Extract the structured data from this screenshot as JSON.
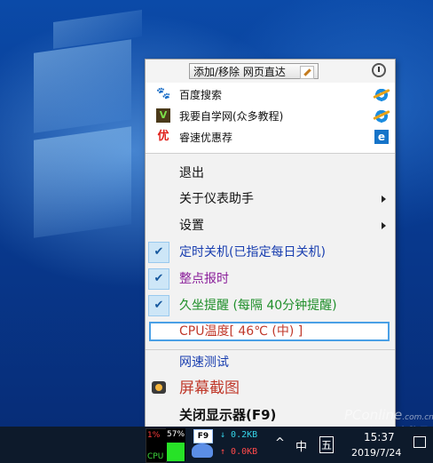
{
  "quick_panel": {
    "add_remove_label": "添加/移除 网页直达",
    "sites": [
      {
        "icon": "baidu-paw-icon",
        "icon_char": "🐾",
        "label": "百度搜索",
        "browser": "ie-icon"
      },
      {
        "icon": "woyaozixue-icon",
        "icon_char": "V",
        "label": "我要自学网(众多教程)",
        "browser": "ie-icon"
      },
      {
        "icon": "youhui-icon",
        "icon_char": "优",
        "label": "睿速优惠荐",
        "browser": "edge-icon"
      }
    ]
  },
  "menu": {
    "exit": "退出",
    "about": "关于仪表助手",
    "settings": "设置",
    "shutdown": "定时关机(已指定每日关机)",
    "hourly": "整点报时",
    "sedentary": "久坐提醒 (每隔 40分钟提醒)",
    "cpu_temp": "CPU温度[ 46℃ (中) ]",
    "speed_test": "网速测试",
    "screenshot": "屏幕截图",
    "monitor_off": "关闭显示器(F9)"
  },
  "colors": {
    "shutdown": "#1a3fb0",
    "hourly": "#8a1f9a",
    "sedentary": "#1f8f2a",
    "cpu_temp": "#c0392b",
    "speed_test": "#1a3fb0",
    "screenshot": "#c0392b",
    "monitor_off": "#111111"
  },
  "taskbar": {
    "cpu_percent": "1%",
    "cpu_label": "CPU",
    "mem_percent": "57%",
    "mem_level": 0.57,
    "f9_label": "F9",
    "net_down": "0.2KB",
    "net_up": "0.0KB",
    "chevron": "^",
    "ime_lang": "中",
    "ime_mode": "五",
    "time": "15:37",
    "date": "2019/7/24"
  }
}
